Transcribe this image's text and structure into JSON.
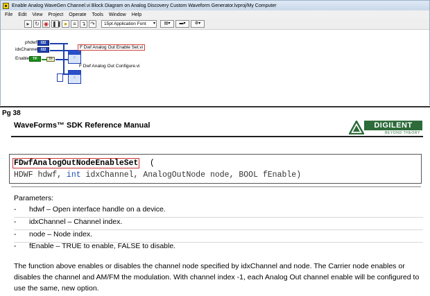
{
  "window": {
    "title": "Enable Analog WaveGen Channel.vi Block Diagram on Analog Discovery Custom Waveform Generator.lvproj/My Computer"
  },
  "menu": [
    "File",
    "Edit",
    "View",
    "Project",
    "Operate",
    "Tools",
    "Window",
    "Help"
  ],
  "toolbar": {
    "font_value": "15pt Application Font"
  },
  "diagram": {
    "inputs": [
      {
        "label": "phdwf",
        "type": "I32"
      },
      {
        "label": "idxChannel",
        "type": "I32"
      },
      {
        "label": "Enable",
        "type": "TF"
      }
    ],
    "tf_const": "TF",
    "subvis": [
      {
        "label": "F Dwf Analog Out Enable Set.vi"
      },
      {
        "label": "F Dwf Analog Out Configure.vi"
      }
    ]
  },
  "manual": {
    "page": "Pg 38",
    "title": "WaveForms™ SDK Reference Manual",
    "logo_name": "DIGILENT",
    "logo_tag": "BEYOND THEORY",
    "function_name": "FDwfAnalogOutNodeEnableSet",
    "paren_open": "(",
    "sig_parts": [
      "HDWF hdwf, ",
      "int",
      " idxChannel, AnalogOutNode node, BOOL fEnable)"
    ],
    "params_heading": "Parameters:",
    "params": [
      {
        "dash": "-",
        "text": "hdwf – Open interface handle on a device."
      },
      {
        "dash": "-",
        "text": "idxChannel – Channel index."
      },
      {
        "dash": "-",
        "text": "node – Node index."
      },
      {
        "dash": "-",
        "text": "fEnable – TRUE to enable, FALSE to disable."
      }
    ],
    "description": "The function above enables or disables the channel node specified by idxChannel and node. The Carrier node enables or disables the channel and AM/FM the modulation. With channel index -1, each Analog Out channel enable will be configured to use the same, new option."
  },
  "colors": {
    "logo_green": "#2d6b3a",
    "highlight_red": "#d03030",
    "keyword_blue": "#1d4fb0"
  }
}
